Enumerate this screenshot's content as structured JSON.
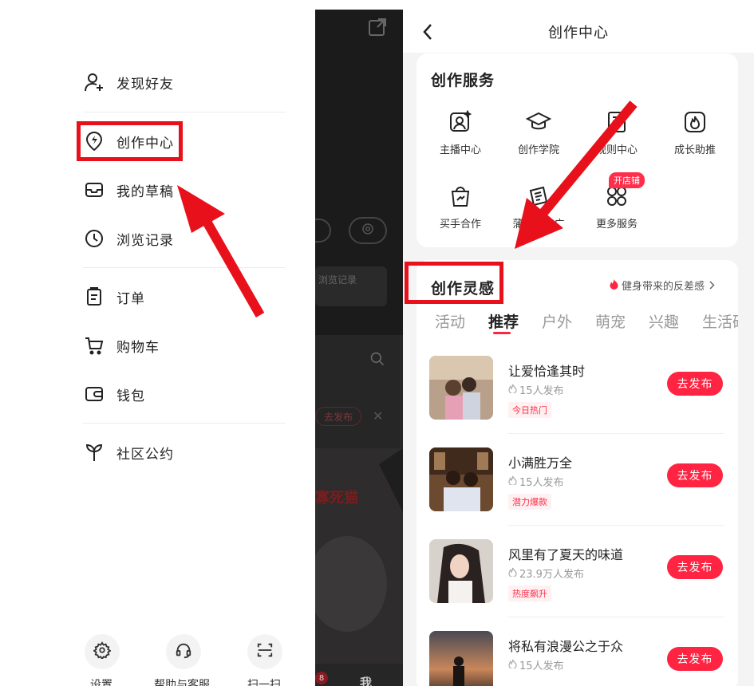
{
  "drawer": {
    "menu": [
      {
        "label": "发现好友",
        "icon": "add-user-icon"
      },
      {
        "label": "创作中心",
        "icon": "lightning-bulb-icon"
      },
      {
        "label": "我的草稿",
        "icon": "inbox-icon"
      },
      {
        "label": "浏览记录",
        "icon": "clock-icon"
      },
      {
        "label": "订单",
        "icon": "clipboard-icon"
      },
      {
        "label": "购物车",
        "icon": "cart-icon"
      },
      {
        "label": "钱包",
        "icon": "wallet-icon"
      },
      {
        "label": "社区公约",
        "icon": "sprout-icon"
      }
    ],
    "bottom": [
      {
        "label": "设置",
        "icon": "gear-icon"
      },
      {
        "label": "帮助与客服",
        "icon": "headset-icon"
      },
      {
        "label": "扫一扫",
        "icon": "scan-icon"
      }
    ]
  },
  "background_page": {
    "text1": "浏览记录",
    "publish_label": "去发布",
    "cat_text": "寡死猫",
    "tab_label": "我",
    "badge_count": "8"
  },
  "creator": {
    "nav_title": "创作中心",
    "services_title": "创作服务",
    "services": [
      {
        "label": "主播中心",
        "icon": "anchor-icon"
      },
      {
        "label": "创作学院",
        "icon": "graduation-cap-icon"
      },
      {
        "label": "规则中心",
        "icon": "rules-book-icon"
      },
      {
        "label": "成长助推",
        "icon": "flame-icon"
      },
      {
        "label": "买手合作",
        "icon": "shopping-bag-icon"
      },
      {
        "label": "蒲公英推广",
        "icon": "ticket-icon"
      },
      {
        "label": "更多服务",
        "icon": "grid-dots-icon"
      }
    ],
    "shop_badge": "开店铺",
    "inspiration_title": "创作灵感",
    "hot_topic": "健身带来的反差感",
    "tabs": [
      "活动",
      "推荐",
      "户外",
      "萌宠",
      "兴趣",
      "生活碎"
    ],
    "active_tab": 1,
    "items": [
      {
        "title": "让爱恰逢其时",
        "sub": "15人发布",
        "tag": "今日热门",
        "action": "去发布"
      },
      {
        "title": "小满胜万全",
        "sub": "15人发布",
        "tag": "潜力爆款",
        "action": "去发布"
      },
      {
        "title": "风里有了夏天的味道",
        "sub": "23.9万人发布",
        "tag": "热度飙升",
        "action": "去发布"
      },
      {
        "title": "将私有浪漫公之于众",
        "sub": "15人发布",
        "tag": "",
        "action": "去发布"
      }
    ]
  },
  "colors": {
    "accent": "#ff2442",
    "annotation": "#e8111b",
    "dark_overlay": "#1b1b1b"
  }
}
